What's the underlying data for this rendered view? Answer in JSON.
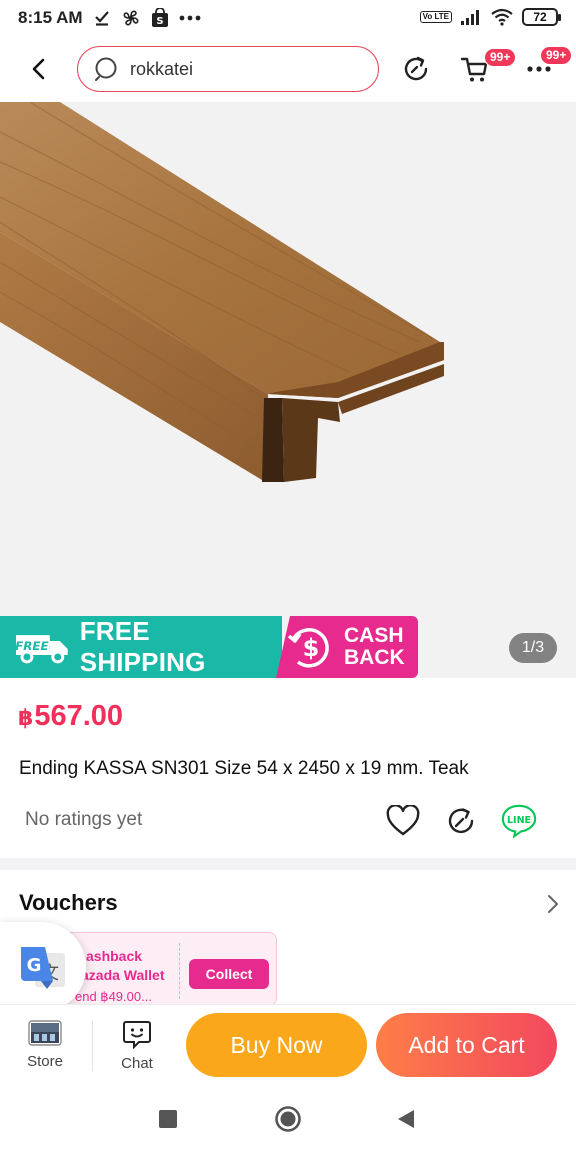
{
  "status_bar": {
    "time": "8:15 AM",
    "volte": "Vo LTE",
    "battery": "72"
  },
  "header": {
    "search_value": "rokkatei",
    "cart_badge": "99+",
    "more_badge": "99+"
  },
  "gallery": {
    "page_indicator": "1/3"
  },
  "promo": {
    "free_icon_text": "FREE",
    "free_shipping": "FREE SHIPPING",
    "cashback_line1": "CASH",
    "cashback_line2": "BACK"
  },
  "product": {
    "currency": "฿",
    "price": "567.00",
    "title": "Ending KASSA SN301 Size 54 x 2450 x 19 mm. Teak",
    "ratings": "No ratings yet"
  },
  "vouchers": {
    "title": "Vouchers",
    "card": {
      "line1": "ashback",
      "line2": "azada Wallet",
      "line3": "end ฿49.00...",
      "collect_label": "Collect"
    }
  },
  "bottom_bar": {
    "store_label": "Store",
    "chat_label": "Chat",
    "buy_now": "Buy Now",
    "add_to_cart": "Add to Cart"
  },
  "colors": {
    "brand_red": "#f0305a",
    "search_border": "#e8475b",
    "free_shipping_bg": "#1ab8a6",
    "cashback_bg": "#e72b8e",
    "buy_now_bg": "#fba71b",
    "add_to_cart_gradient": [
      "#fd7e47",
      "#f3485e"
    ],
    "line_green": "#06c755"
  },
  "icons": {
    "back": "chevron-left-icon",
    "search": "search-icon",
    "history": "history-icon",
    "cart": "cart-icon",
    "more": "more-icon",
    "wishlist": "heart-icon",
    "share": "share-icon",
    "line": "line-share-icon",
    "translate": "google-translate-icon"
  }
}
